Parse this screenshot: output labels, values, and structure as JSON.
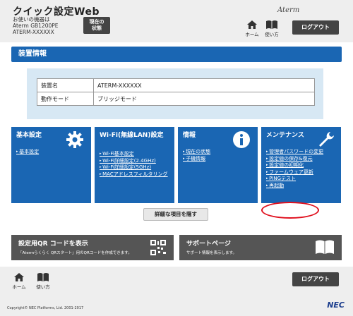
{
  "header": {
    "app_title": "クイック設定Web",
    "device_lines": [
      "お使いの機器は",
      "Aterm GB1200PE",
      "ATERM-XXXXXX"
    ],
    "status_button": [
      "現在の",
      "状態"
    ],
    "brand": "Aterm",
    "home_label": "ホーム",
    "manual_label": "使い方",
    "logout_label": "ログアウト"
  },
  "main": {
    "section_title": "装置情報",
    "info_rows": [
      {
        "key": "装置名",
        "value": "ATERM-XXXXXX"
      },
      {
        "key": "動作モード",
        "value": "ブリッジモード"
      }
    ],
    "tiles": [
      {
        "title": "基本設定",
        "icon": "gear-icon",
        "links": [
          "基本設定"
        ]
      },
      {
        "title": "Wi-Fi(無線LAN)設定",
        "icon": "wifi-icon",
        "links": [
          "Wi-Fi基本設定",
          "Wi-Fi詳細設定(2.4GHz)",
          "Wi-Fi詳細設定(5GHz)",
          "MACアドレスフィルタリング"
        ]
      },
      {
        "title": "情報",
        "icon": "info-icon",
        "links": [
          "現在の状態",
          "子機情報"
        ]
      },
      {
        "title": "メンテナンス",
        "icon": "wrench-icon",
        "links": [
          "管理者パスワードの変更",
          "設定値の保存&復元",
          "設定値の初期化",
          "ファームウェア更新",
          "PINGテスト",
          "再起動"
        ]
      }
    ],
    "detail_button": "詳細な項目を隠す",
    "banners": [
      {
        "title": "設定用QR コードを表示",
        "subtitle": "「Atermらくらく QRスタート」用のQRコードを作成できます。",
        "icon": "qr-code-icon"
      },
      {
        "title": "サポートページ",
        "subtitle": "サポート情報を表示します。",
        "icon": "book-icon"
      }
    ]
  },
  "footer": {
    "home_label": "ホーム",
    "manual_label": "使い方",
    "logout_label": "ログアウト",
    "copyright": "Copyright© NEC Platforms, Ltd. 2001-2017",
    "brand": "NEC"
  },
  "colors": {
    "accent": "#1a66b3",
    "dark_button": "#444444",
    "highlight_ring": "#e0101e"
  }
}
